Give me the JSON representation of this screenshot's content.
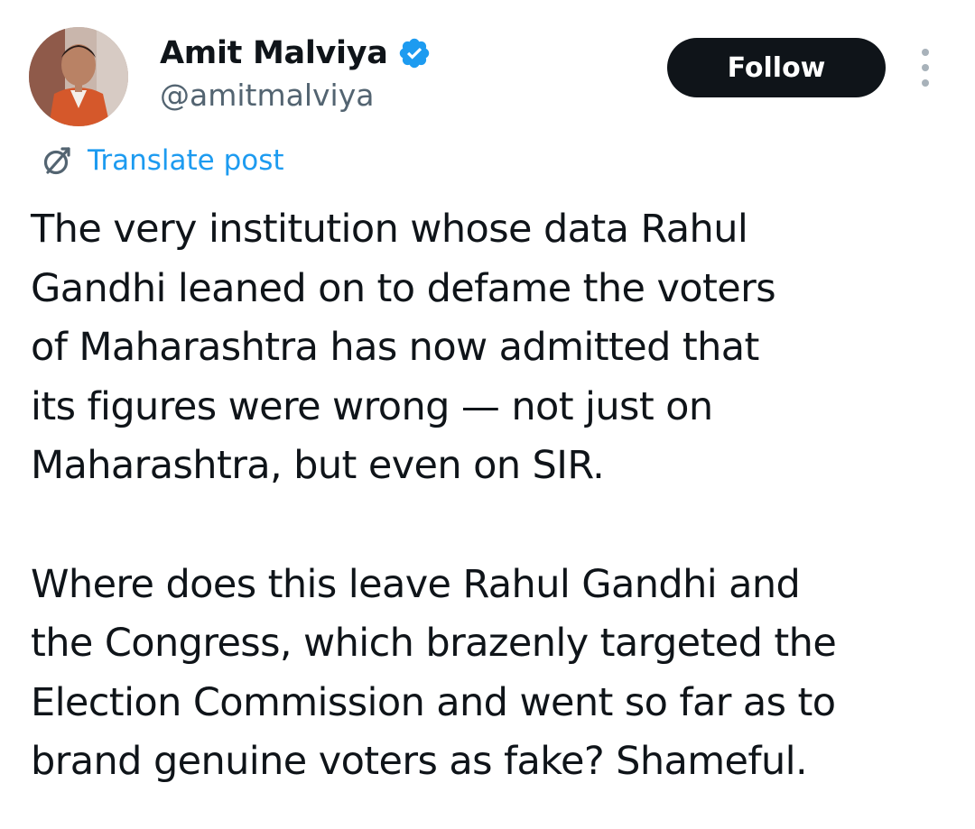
{
  "author": {
    "display_name": "Amit Malviya",
    "handle": "@amitmalviya",
    "verified": true,
    "avatar_icon": "profile-photo-avatar"
  },
  "actions": {
    "follow_label": "Follow",
    "more_icon": "more-vertical-icon"
  },
  "translate": {
    "label": "Translate post",
    "icon": "translate-globe-icon"
  },
  "tweet": {
    "paragraph1": [
      "The very institution whose data Rahul",
      "Gandhi leaned on to defame the voters",
      "of Maharashtra has now admitted that",
      "its figures were wrong — not just on",
      "Maharashtra, but even on SIR."
    ],
    "paragraph2": [
      "Where does this leave Rahul Gandhi and",
      "the Congress, which brazenly targeted the",
      "Election Commission and went so far as to",
      "brand genuine voters as fake? Shameful."
    ]
  },
  "colors": {
    "text_primary": "#0f1419",
    "text_secondary": "#536471",
    "accent_blue": "#1d9bf0",
    "follow_bg": "#0f1419",
    "follow_text": "#ffffff"
  }
}
